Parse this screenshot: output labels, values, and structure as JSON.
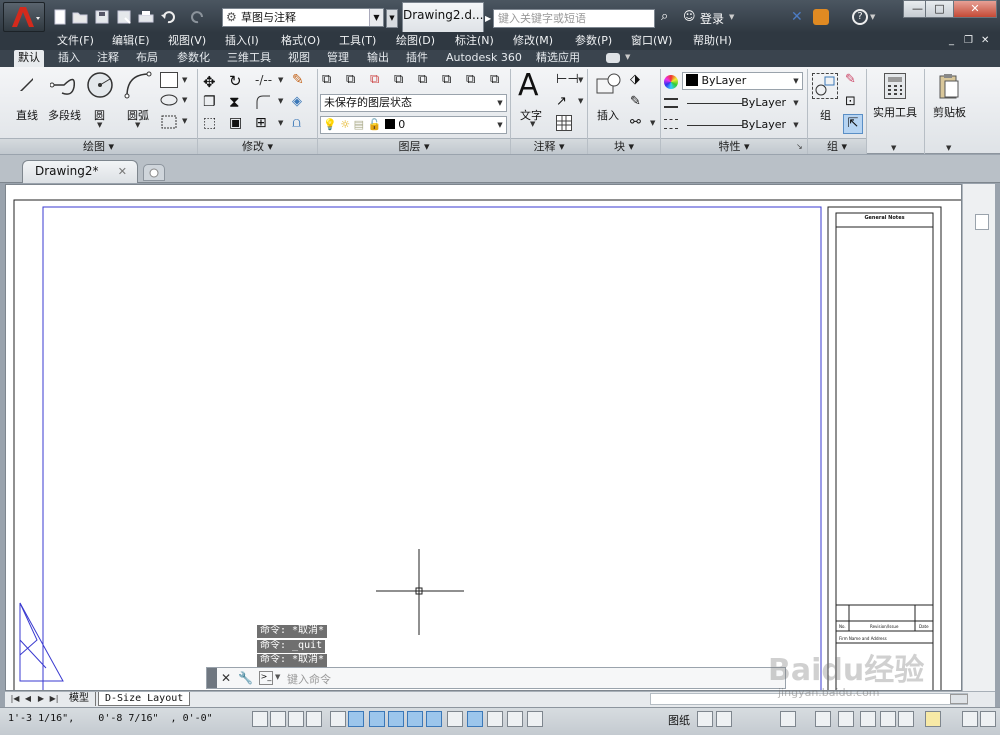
{
  "titlebar": {
    "workspace": "草图与注释",
    "document_title": "Drawing2.d...",
    "search_placeholder": "键入关键字或短语",
    "login": "登录",
    "win_min": "—",
    "win_max": "□",
    "win_close": "✕"
  },
  "menubar": [
    "文件(F)",
    "编辑(E)",
    "视图(V)",
    "插入(I)",
    "格式(O)",
    "工具(T)",
    "绘图(D)",
    "标注(N)",
    "修改(M)",
    "参数(P)",
    "窗口(W)",
    "帮助(H)"
  ],
  "ribbon_tabs": [
    "默认",
    "插入",
    "注释",
    "布局",
    "参数化",
    "三维工具",
    "视图",
    "管理",
    "输出",
    "插件",
    "Autodesk 360",
    "精选应用"
  ],
  "ribbon": {
    "draw": {
      "line": "直线",
      "polyline": "多段线",
      "circle": "圆",
      "arc": "圆弧",
      "title": "绘图 ▾"
    },
    "modify": {
      "title": "修改 ▾"
    },
    "layers": {
      "state": "未保存的图层状态",
      "current": "0",
      "title": "图层 ▾"
    },
    "annotation": {
      "text": "文字",
      "title": "注释 ▾"
    },
    "block": {
      "insert": "插入",
      "title": "块 ▾"
    },
    "properties": {
      "color": "ByLayer",
      "linetype": "ByLayer",
      "lineweight": "ByLayer",
      "title": "特性 ▾"
    },
    "groups": {
      "group": "组",
      "title": "组 ▾"
    },
    "utilities": {
      "label": "实用工具"
    },
    "clipboard": {
      "label": "剪贴板"
    }
  },
  "file_tabs": {
    "active": "Drawing2*",
    "close": "✕"
  },
  "drawing": {
    "title_block_header": "General Notes",
    "title_block_cols": [
      "No.",
      "Revision/Issue",
      "Date"
    ],
    "title_block_row": "Firm Name and Address"
  },
  "command": {
    "history": [
      "命令: *取消*",
      "命令: _quit",
      "命令: *取消*"
    ],
    "placeholder": "键入命令"
  },
  "layout_tabs": [
    "模型",
    "D-Size Layout"
  ],
  "status": {
    "coords": "1'-3 1/16\",    0'-8 7/16\"  , 0'-0\"",
    "paper": "图纸"
  },
  "watermark": {
    "brand": "Baidu经验",
    "url": "jingyan.baidu.com"
  },
  "colors": {
    "accent": "#3b78b8",
    "viewport_border": "#3a3ad0",
    "title_dark": "#2f3841"
  }
}
